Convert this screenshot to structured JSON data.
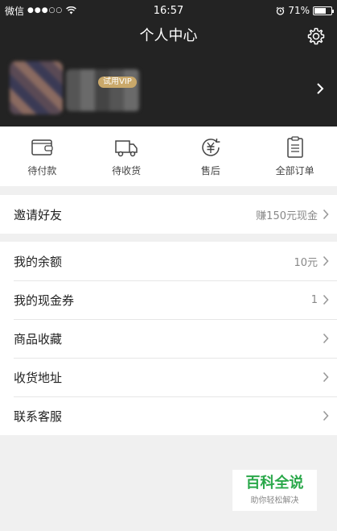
{
  "status_bar": {
    "carrier": "微信",
    "signal": "●●●○○",
    "time": "16:57",
    "battery_percent": "71%",
    "battery_level": 0.71
  },
  "nav": {
    "title": "个人中心",
    "settings_icon": "gear-icon"
  },
  "profile": {
    "vip_badge": "试用VIP"
  },
  "orders": [
    {
      "label": "待付款",
      "icon": "wallet-icon"
    },
    {
      "label": "待收货",
      "icon": "truck-icon"
    },
    {
      "label": "售后",
      "icon": "yuan-refresh-icon"
    },
    {
      "label": "全部订单",
      "icon": "clipboard-icon"
    }
  ],
  "invite": {
    "label": "邀请好友",
    "value": "赚150元现金"
  },
  "account": {
    "items": [
      {
        "label": "我的余额",
        "value": "10元"
      },
      {
        "label": "我的现金券",
        "value": "1"
      },
      {
        "label": "商品收藏",
        "value": ""
      },
      {
        "label": "收货地址",
        "value": ""
      },
      {
        "label": "联系客服",
        "value": ""
      }
    ]
  },
  "watermark": {
    "title": "百科全说",
    "subtitle": "助你轻松解决"
  },
  "colors": {
    "header_bg": "#232323",
    "vip_gold": "#c9a86a",
    "watermark_green": "#2aa84a"
  }
}
